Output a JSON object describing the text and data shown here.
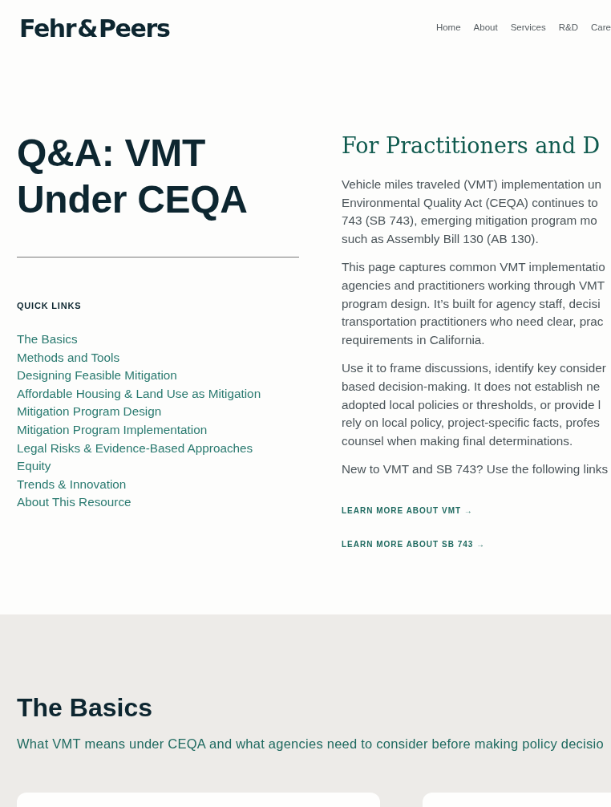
{
  "header": {
    "logo": "Fehr & Peers",
    "nav": [
      {
        "label": "Home"
      },
      {
        "label": "About"
      },
      {
        "label": "Services"
      },
      {
        "label": "R&D"
      },
      {
        "label": "Care"
      }
    ]
  },
  "hero": {
    "title": "Q&A: VMT Under CEQA",
    "quick_links": {
      "heading": "QUICK LINKS",
      "links": [
        "The Basics",
        "Methods and Tools",
        "Designing Feasible Mitigation",
        "Affordable Housing & Land Use as Mitigation",
        "Mitigation Program Design",
        "Mitigation Program Implementation",
        "Legal Risks & Evidence-Based Approaches",
        "Equity",
        "Trends & Innovation",
        "About This Resource"
      ]
    }
  },
  "intro": {
    "heading": "For Practitioners and D",
    "paragraphs": [
      {
        "lines": [
          "Vehicle miles traveled (VMT) implementation un",
          "Environmental Quality Act (CEQA) continues to",
          "743 (SB 743), emerging mitigation program mo",
          "such as Assembly Bill 130 (AB 130)."
        ]
      },
      {
        "lines": [
          "This page captures common VMT implementatio",
          "agencies and practitioners working through VMT",
          "program design. It’s built for agency staff, decisi",
          "transportation practitioners who need clear, prac",
          "requirements in California."
        ]
      },
      {
        "lines": [
          "Use it to frame discussions, identify key consider",
          "based decision-making. It does not establish ne",
          "adopted local policies or thresholds, or provide l",
          "rely on local policy, project-specific facts, profes",
          "counsel when making final determinations."
        ]
      },
      {
        "lines": [
          "New to VMT and SB 743? Use the following links"
        ]
      }
    ],
    "links": [
      "LEARN MORE ABOUT VMT →",
      "LEARN MORE ABOUT SB 743 →"
    ]
  },
  "section": {
    "title": "The Basics",
    "subtitle": "What VMT means under CEQA and what agencies need to consider before making policy decisio"
  }
}
